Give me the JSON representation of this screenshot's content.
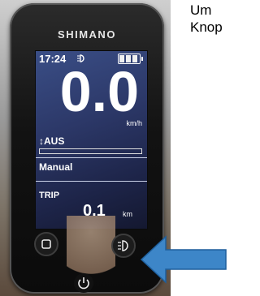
{
  "side_text": {
    "line1": "Um",
    "line2": "Knop"
  },
  "device": {
    "brand": "SHIMANO",
    "screen": {
      "time": "17:24",
      "battery_level": 1.0,
      "speed": "0.0",
      "speed_unit": "km/h",
      "assist_label": "AUS",
      "mode": "Manual",
      "trip_label": "TRIP",
      "trip_value": "0.1",
      "trip_unit": "km"
    },
    "buttons": {
      "left": "square-button",
      "right": "light-button",
      "power": "power-button"
    }
  },
  "colors": {
    "arrow": "#3d86c8",
    "screen": "#2c3868"
  }
}
